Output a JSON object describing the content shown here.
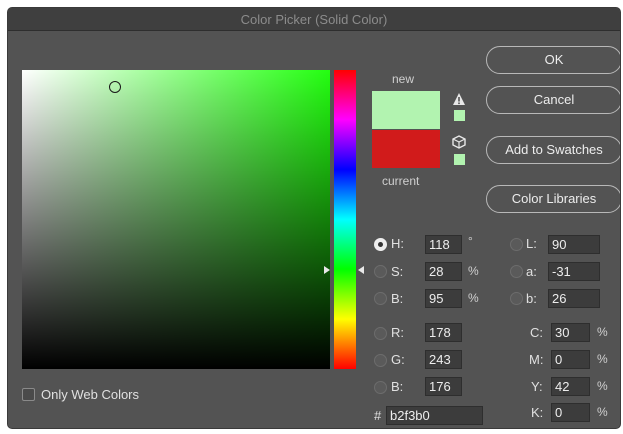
{
  "window": {
    "title": "Color Picker (Solid Color)"
  },
  "swatches": {
    "new_label": "new",
    "current_label": "current",
    "new_color": "#b2f3b0",
    "current_color": "#d11b1b"
  },
  "buttons": {
    "ok": "OK",
    "cancel": "Cancel",
    "add_to_swatches": "Add to Swatches",
    "color_libraries": "Color Libraries"
  },
  "hsb": {
    "h_label": "H:",
    "h_value": "118",
    "h_unit": "°",
    "s_label": "S:",
    "s_value": "28",
    "s_unit": "%",
    "b_label": "B:",
    "b_value": "95",
    "b_unit": "%"
  },
  "rgb": {
    "r_label": "R:",
    "r_value": "178",
    "g_label": "G:",
    "g_value": "243",
    "b_label": "B:",
    "b_value": "176"
  },
  "lab": {
    "l_label": "L:",
    "l_value": "90",
    "a_label": "a:",
    "a_value": "-31",
    "b_label": "b:",
    "b_value": "26"
  },
  "cmyk": {
    "c_label": "C:",
    "c_value": "30",
    "c_unit": "%",
    "m_label": "M:",
    "m_value": "0",
    "m_unit": "%",
    "y_label": "Y:",
    "y_value": "42",
    "y_unit": "%",
    "k_label": "K:",
    "k_value": "0",
    "k_unit": "%"
  },
  "hex": {
    "label": "#",
    "value": "b2f3b0"
  },
  "options": {
    "only_web_colors": "Only Web Colors"
  },
  "icons": {
    "gamut_warning": "warning-triangle-icon",
    "web_safe": "cube-icon"
  }
}
